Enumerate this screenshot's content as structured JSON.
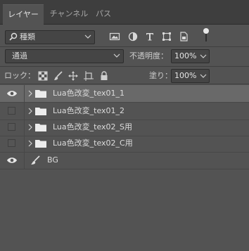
{
  "tabs": [
    {
      "label": "レイヤー",
      "active": true
    },
    {
      "label": "チャンネル",
      "active": false
    },
    {
      "label": "パス",
      "active": false
    }
  ],
  "filter": {
    "kind_label": "種類",
    "icons": [
      "image-filter-icon",
      "adjustment-filter-icon",
      "type-filter-icon",
      "shape-filter-icon",
      "smart-object-filter-icon"
    ],
    "toggle": "filter-toggle"
  },
  "blend": {
    "mode": "通過",
    "opacity_label": "不透明度：",
    "opacity_value": "100%"
  },
  "lock": {
    "label": "ロック：",
    "icons": [
      "lock-transparent-icon",
      "lock-image-icon",
      "lock-position-icon",
      "lock-artboard-icon",
      "lock-all-icon"
    ],
    "fill_label": "塗り：",
    "fill_value": "100%"
  },
  "layers": [
    {
      "name": "Lua色改変_tex01_1",
      "type": "group",
      "visible": true,
      "selected": true
    },
    {
      "name": "Lua色改変_tex01_2",
      "type": "group",
      "visible": false,
      "selected": false
    },
    {
      "name": "Lua色改変_tex02_S用",
      "type": "group",
      "visible": false,
      "selected": false
    },
    {
      "name": "Lua色改変_tex02_C用",
      "type": "group",
      "visible": false,
      "selected": false
    },
    {
      "name": "BG",
      "type": "layer",
      "visible": true,
      "selected": false
    }
  ],
  "colors": {
    "panel_bg": "#535353",
    "selected_row": "#696969",
    "tab_bg": "#3e3e3e"
  }
}
